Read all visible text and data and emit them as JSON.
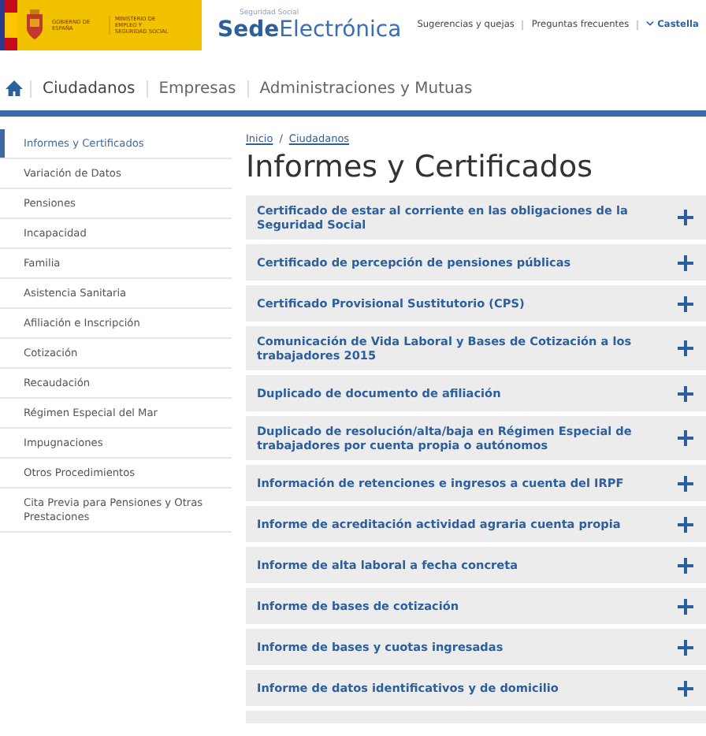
{
  "header": {
    "logo_texts": [
      "GOBIERNO DE ESPAÑA",
      "MINISTERIO DE EMPLEO Y SEGURIDAD SOCIAL"
    ],
    "site_super": "Seguridad Social",
    "site_title": "**Sede**Electrónica",
    "links": [
      {
        "label": "Sugerencias y quejas",
        "kind": "link"
      },
      {
        "label": "Preguntas frecuentes",
        "kind": "link"
      },
      {
        "label": "Castella",
        "kind": "language"
      }
    ]
  },
  "nav": {
    "items": [
      {
        "label": "Ciudadanos",
        "selected": true
      },
      {
        "label": "Empresas",
        "selected": false
      },
      {
        "label": "Administraciones y Mutuas",
        "selected": false
      }
    ]
  },
  "sidebar": {
    "items": [
      {
        "label": "Informes y Certificados",
        "selected": true
      },
      {
        "label": "Variación de Datos",
        "selected": false
      },
      {
        "label": "Pensiones",
        "selected": false
      },
      {
        "label": "Incapacidad",
        "selected": false
      },
      {
        "label": "Familia",
        "selected": false
      },
      {
        "label": "Asistencia Sanitaria",
        "selected": false
      },
      {
        "label": "Afiliación e Inscripción",
        "selected": false
      },
      {
        "label": "Cotización",
        "selected": false
      },
      {
        "label": "Recaudación",
        "selected": false
      },
      {
        "label": "Régimen Especial del Mar",
        "selected": false
      },
      {
        "label": "Impugnaciones",
        "selected": false
      },
      {
        "label": "Otros Procedimientos",
        "selected": false
      },
      {
        "label": "Cita Previa para Pensiones y Otras Prestaciones",
        "selected": false
      }
    ]
  },
  "breadcrumb": [
    "Inicio",
    "Ciudadanos"
  ],
  "breadcrumb_separator": "/",
  "page_title": "Informes y Certificados",
  "accordion": [
    {
      "label": "Certificado de estar al corriente en las obligaciones de la Seguridad Social",
      "expanded": false
    },
    {
      "label": "Certificado de percepción de pensiones públicas",
      "expanded": false
    },
    {
      "label": "Certificado Provisional Sustitutorio (CPS)",
      "expanded": false
    },
    {
      "label": "Comunicación de Vida Laboral y Bases de Cotización a los trabajadores 2015",
      "expanded": false
    },
    {
      "label": "Duplicado de documento de afiliación",
      "expanded": false
    },
    {
      "label": "Duplicado de resolución/alta/baja en Régimen Especial de trabajadores por cuenta propia o autónomos",
      "expanded": false
    },
    {
      "label": "Información de retenciones e ingresos a cuenta del IRPF",
      "expanded": false
    },
    {
      "label": "Informe de acreditación actividad agraria cuenta propia",
      "expanded": false
    },
    {
      "label": "Informe de alta laboral a fecha concreta",
      "expanded": false
    },
    {
      "label": "Informe de bases de cotización",
      "expanded": false
    },
    {
      "label": "Informe de bases y cuotas ingresadas",
      "expanded": false
    },
    {
      "label": "Informe de datos identificativos y de domicilio",
      "expanded": false
    }
  ]
}
